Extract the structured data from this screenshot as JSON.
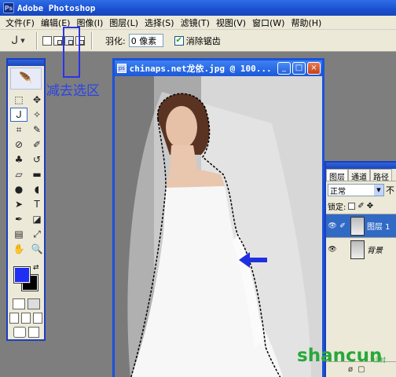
{
  "app": {
    "title": "Adobe Photoshop",
    "logo": "Ps"
  },
  "menubar": {
    "items": [
      "文件(F)",
      "编辑(E)",
      "图像(I)",
      "图层(L)",
      "选择(S)",
      "滤镜(T)",
      "视图(V)",
      "窗口(W)",
      "帮助(H)"
    ]
  },
  "options": {
    "feather_label": "羽化:",
    "feather_value": "0 像素",
    "antialias_label": "消除锯齿",
    "antialias_checked": true,
    "selection_modes": [
      "new-selection",
      "add-to-selection",
      "subtract-from-selection",
      "intersect-selection"
    ],
    "active_mode": "subtract-from-selection"
  },
  "annotation": {
    "text": "减去选区",
    "color": "#2a44e6"
  },
  "document": {
    "title": "chinaps.net龙依.jpg @ 100...",
    "buttons": [
      "_",
      "□",
      "×"
    ]
  },
  "toolbox": {
    "foreground_color": "#1f2ef0",
    "background_color": "#000000",
    "active_tool": "lasso-tool"
  },
  "layers": {
    "tabs": [
      "图层",
      "通道",
      "路径"
    ],
    "blend_mode": "正常",
    "opacity_label": "不",
    "lock_label": "锁定:",
    "rows": [
      {
        "name": "图层 1",
        "selected": true
      },
      {
        "name": "背景",
        "selected": false
      }
    ]
  },
  "watermark": {
    "text": "shancun",
    "sub": "山村"
  }
}
